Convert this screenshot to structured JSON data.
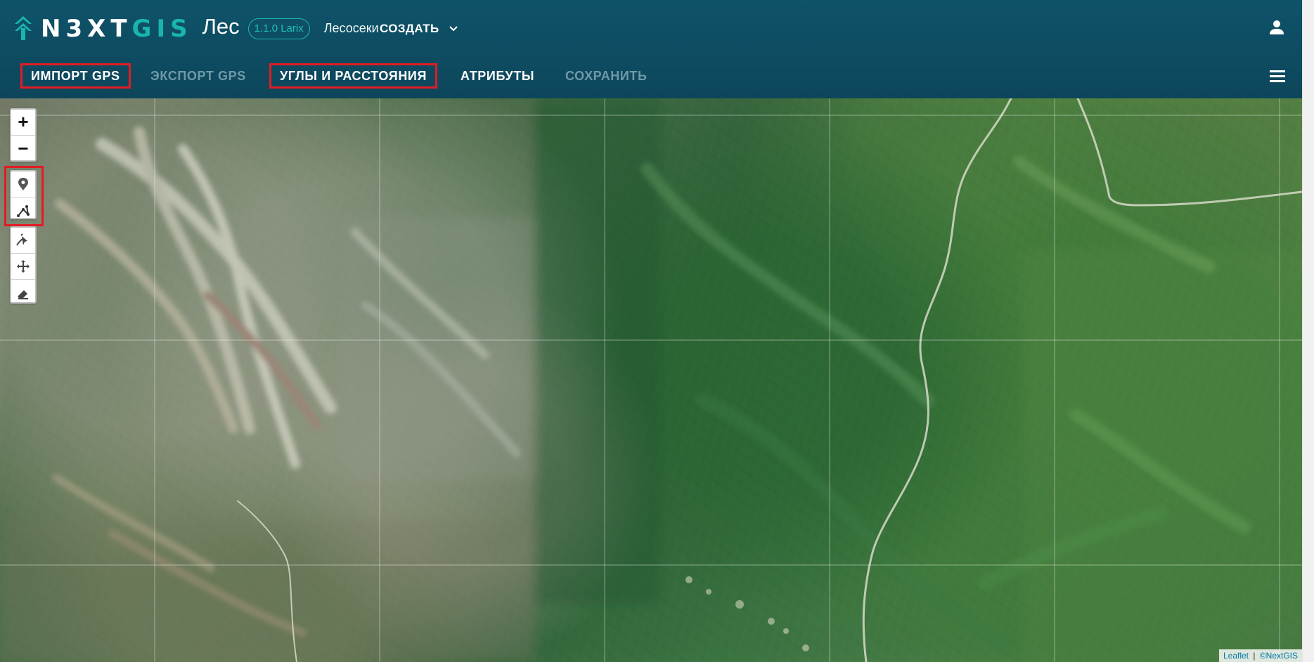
{
  "header": {
    "brand_next": "N3XT",
    "brand_gis": "GIS",
    "product": "Лес",
    "version": "1.1.0 Larix",
    "layer": "Лесосеки",
    "create_menu_label": "СОЗДАТЬ",
    "user_icon": "user-icon",
    "create_icon": "chevron-down-icon",
    "brand_color": "#18b5b0"
  },
  "toolbar": {
    "import_gps": "ИМПОРТ GPS",
    "export_gps": "ЭКСПОРТ GPS",
    "angles_distances": "УГЛЫ И РАССТОЯНИЯ",
    "attributes": "АТРИБУТЫ",
    "save": "СОХРАНИТЬ",
    "hamburger_icon": "hamburger-icon"
  },
  "map": {
    "zoom_in": "+",
    "zoom_out": "−",
    "marker_icon": "location-pin-icon",
    "polyline_icon": "polyline-icon",
    "draw_icon": "draw-icon",
    "move_icon": "move-icon",
    "eraser_icon": "eraser-icon",
    "attribution_leaflet": "Leaflet",
    "attribution_separator": "|",
    "attribution_nextgis": "©NextGIS"
  },
  "colors": {
    "header_bg": "#0f4b61",
    "accent_teal": "#18b5b0",
    "highlight_red": "#e31b23",
    "disabled_text": "#6e9aa7"
  }
}
